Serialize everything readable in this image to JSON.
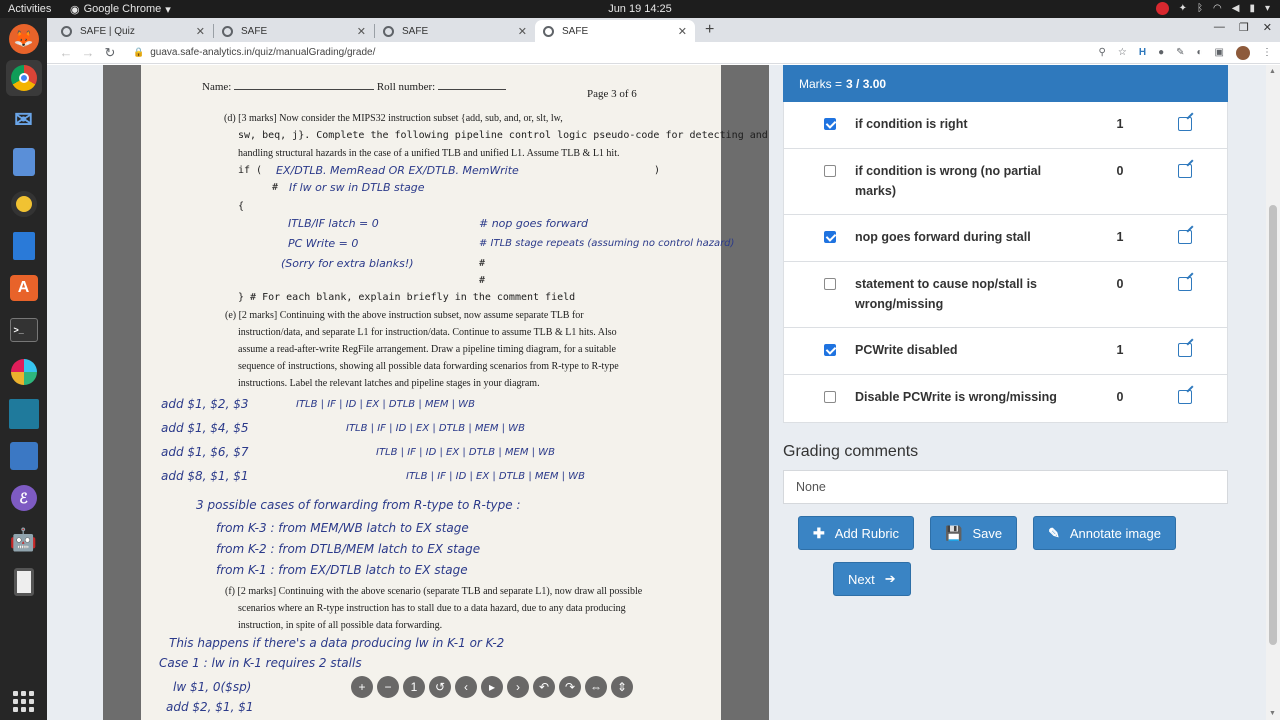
{
  "topbar": {
    "activities": "Activities",
    "app_name": "Google Chrome",
    "clock": "Jun 19  14:25"
  },
  "dock": {
    "items": [
      "firefox-icon",
      "chrome-icon",
      "thunderbird-icon",
      "notes-icon",
      "rhythmbox-icon",
      "writer-icon",
      "software-icon",
      "terminal-icon",
      "slack-icon",
      "screen-icon",
      "presentation-icon",
      "emacs-icon",
      "android-icon",
      "media-icon"
    ]
  },
  "tabs": [
    {
      "title": "SAFE | Quiz",
      "active": false
    },
    {
      "title": "SAFE",
      "active": false
    },
    {
      "title": "SAFE",
      "active": false
    },
    {
      "title": "SAFE",
      "active": true
    }
  ],
  "address": {
    "url": "guava.safe-analytics.in/quiz/manualGrading/grade/"
  },
  "scan": {
    "name_label": "Name:",
    "roll_label": "Roll number:",
    "page_label": "Page 3 of 6",
    "lines": [
      "(d) [3 marks] Now consider the MIPS32 instruction subset {add, sub, and, or, slt, lw,",
      "sw, beq, j}. Complete the following pipeline control logic pseudo-code for detecting and",
      "handling structural hazards in the case of a unified TLB and unified L1.  Assume TLB & L1 hit.",
      "if (",
      "#",
      "{",
      "} # For each blank, explain briefly in the comment field",
      "(e) [2 marks] Continuing with the above instruction subset, now assume separate TLB for",
      "instruction/data, and separate L1 for instruction/data.  Continue to assume TLB & L1 hits. Also",
      "assume a read-after-write RegFile arrangement. Draw a pipeline timing diagram, for a suitable",
      "sequence of instructions, showing all possible data forwarding scenarios from R-type to R-type",
      "instructions.  Label the relevant latches and pipeline stages in your diagram.",
      "(f) [2 marks] Continuing with the above scenario (separate TLB and separate L1), now draw all possible",
      "scenarios where an R-type instruction has to stall due to a data hazard, due to any data producing",
      "instruction, in spite of all possible data forwarding."
    ],
    "handwriting": [
      "EX/DTLB. MemRead  OR  EX/DTLB. MemWrite",
      "If lw or sw in DTLB stage",
      "ITLB/IF latch = 0",
      "# nop goes forward",
      "PC Write = 0",
      "# ITLB stage repeats (assuming no control hazard)",
      "(Sorry for extra blanks!)",
      "add $1, $2, $3",
      "add $1, $4, $5",
      "add $1, $6, $7",
      "add $8, $1, $1",
      "ITLB | IF | ID | EX | DTLB | MEM | WB",
      "3 possible cases of forwarding from R-type to R-type :",
      "from K-3 :   from MEM/WB latch to EX stage",
      "from K-2 :   from DTLB/MEM latch to EX stage",
      "from K-1 :   from  EX/DTLB latch to EX stage",
      "This happens if there's a data producing lw in K-1 or K-2",
      "Case 1 : lw in K-1 requires 2 stalls",
      "lw $1, 0($sp)",
      "add $2, $1, $1"
    ]
  },
  "marks": {
    "label": "Marks =",
    "value": "3 / 3.00"
  },
  "rubrics": [
    {
      "text": "if condition is right",
      "mark": "1",
      "checked": true
    },
    {
      "text": "if condition is wrong (no partial marks)",
      "mark": "0",
      "checked": false
    },
    {
      "text": "nop goes forward during stall",
      "mark": "1",
      "checked": true
    },
    {
      "text": "statement to cause nop/stall is wrong/missing",
      "mark": "0",
      "checked": false
    },
    {
      "text": "PCWrite disabled",
      "mark": "1",
      "checked": true
    },
    {
      "text": "Disable PCWrite is wrong/missing",
      "mark": "0",
      "checked": false
    }
  ],
  "comments": {
    "title": "Grading comments",
    "value": "None"
  },
  "buttons": {
    "add_rubric": "Add Rubric",
    "save": "Save",
    "annotate": "Annotate image",
    "next": "Next"
  },
  "colors": {
    "primary": "#2f79bd",
    "checkbox": "#1f73e0",
    "handwriting": "#2b3a8a"
  }
}
